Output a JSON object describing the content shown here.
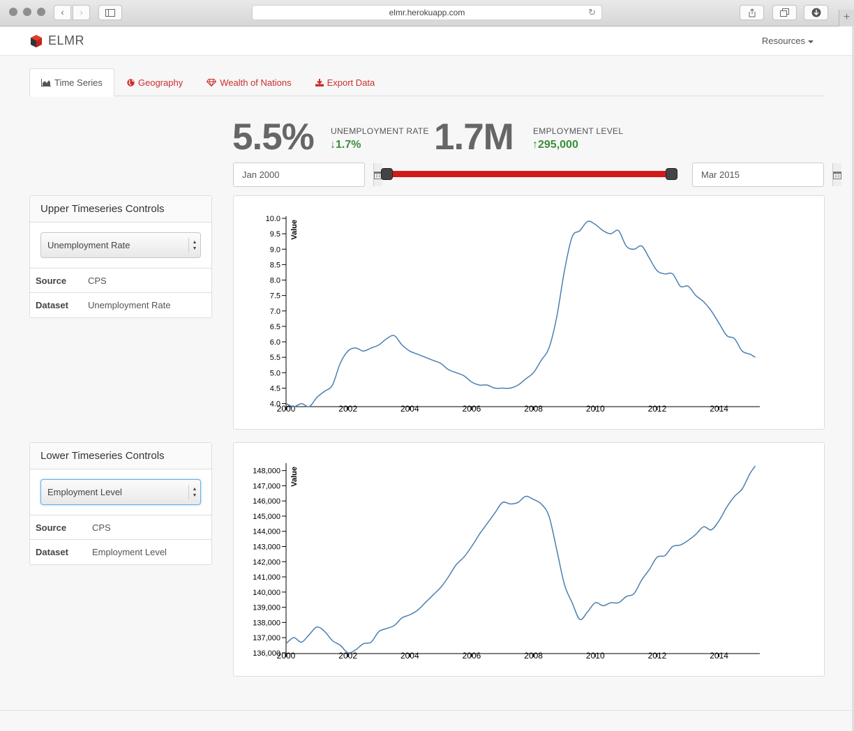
{
  "browser": {
    "url": "elmr.herokuapp.com"
  },
  "navbar": {
    "brand": "ELMR",
    "resources_label": "Resources"
  },
  "tabs": [
    {
      "label": "Time Series",
      "icon": "area-chart-icon",
      "active": true
    },
    {
      "label": "Geography",
      "icon": "globe-icon",
      "active": false
    },
    {
      "label": "Wealth of Nations",
      "icon": "diamond-icon",
      "active": false
    },
    {
      "label": "Export Data",
      "icon": "download-icon",
      "active": false
    }
  ],
  "stats": {
    "unemployment": {
      "value": "5.5%",
      "label": "UNEMPLOYMENT RATE",
      "change": "1.7%",
      "direction": "down"
    },
    "employment": {
      "value": "1.7M",
      "label": "EMPLOYMENT LEVEL",
      "change": "295,000",
      "direction": "up"
    }
  },
  "date_range": {
    "start": "Jan 2000",
    "end": "Mar 2015"
  },
  "colors": {
    "accent": "#c9302c",
    "slider": "#d11a1a",
    "positive": "#3c8d3c",
    "line": "#4a7fb0"
  },
  "upper_panel": {
    "title": "Upper Timeseries Controls",
    "selected": "Unemployment Rate",
    "rows": [
      {
        "key": "Source",
        "value": "CPS"
      },
      {
        "key": "Dataset",
        "value": "Unemployment Rate"
      }
    ]
  },
  "lower_panel": {
    "title": "Lower Timeseries Controls",
    "selected": "Employment Level",
    "rows": [
      {
        "key": "Source",
        "value": "CPS"
      },
      {
        "key": "Dataset",
        "value": "Employment Level"
      }
    ]
  },
  "chart_data": [
    {
      "type": "line",
      "ylabel": "Value",
      "xlabel": "",
      "xlim": [
        2000,
        2015.25
      ],
      "ylim": [
        3.9,
        10.0
      ],
      "xticks": [
        2000,
        2002,
        2004,
        2006,
        2008,
        2010,
        2012,
        2014
      ],
      "yticks": [
        4.0,
        4.5,
        5.0,
        5.5,
        6.0,
        6.5,
        7.0,
        7.5,
        8.0,
        8.5,
        9.0,
        9.5,
        10.0
      ],
      "ytick_labels": [
        "4.0",
        "4.5",
        "5.0",
        "5.5",
        "6.0",
        "6.5",
        "7.0",
        "7.5",
        "8.0",
        "8.5",
        "9.0",
        "9.5",
        "10.0"
      ],
      "x": [
        2000.0,
        2000.25,
        2000.5,
        2000.75,
        2001.0,
        2001.25,
        2001.5,
        2001.75,
        2002.0,
        2002.25,
        2002.5,
        2002.75,
        2003.0,
        2003.25,
        2003.5,
        2003.75,
        2004.0,
        2004.25,
        2004.5,
        2004.75,
        2005.0,
        2005.25,
        2005.5,
        2005.75,
        2006.0,
        2006.25,
        2006.5,
        2006.75,
        2007.0,
        2007.25,
        2007.5,
        2007.75,
        2008.0,
        2008.25,
        2008.5,
        2008.75,
        2009.0,
        2009.25,
        2009.5,
        2009.75,
        2010.0,
        2010.25,
        2010.5,
        2010.75,
        2011.0,
        2011.25,
        2011.5,
        2011.75,
        2012.0,
        2012.25,
        2012.5,
        2012.75,
        2013.0,
        2013.25,
        2013.5,
        2013.75,
        2014.0,
        2014.25,
        2014.5,
        2014.75,
        2015.0,
        2015.17
      ],
      "y": [
        4.0,
        3.9,
        4.0,
        3.9,
        4.2,
        4.4,
        4.6,
        5.3,
        5.7,
        5.8,
        5.7,
        5.8,
        5.9,
        6.1,
        6.2,
        5.9,
        5.7,
        5.6,
        5.5,
        5.4,
        5.3,
        5.1,
        5.0,
        4.9,
        4.7,
        4.6,
        4.6,
        4.5,
        4.5,
        4.5,
        4.6,
        4.8,
        5.0,
        5.4,
        5.8,
        6.8,
        8.3,
        9.4,
        9.6,
        9.9,
        9.8,
        9.6,
        9.5,
        9.6,
        9.1,
        9.0,
        9.1,
        8.7,
        8.3,
        8.2,
        8.2,
        7.8,
        7.8,
        7.5,
        7.3,
        7.0,
        6.6,
        6.2,
        6.1,
        5.7,
        5.6,
        5.5
      ]
    },
    {
      "type": "line",
      "ylabel": "Value",
      "xlabel": "",
      "xlim": [
        2000,
        2015.25
      ],
      "ylim": [
        135950,
        148350
      ],
      "xticks": [
        2000,
        2002,
        2004,
        2006,
        2008,
        2010,
        2012,
        2014
      ],
      "yticks": [
        136000,
        137000,
        138000,
        139000,
        140000,
        141000,
        142000,
        143000,
        144000,
        145000,
        146000,
        147000,
        148000
      ],
      "ytick_labels": [
        "136,000",
        "137,000",
        "138,000",
        "139,000",
        "140,000",
        "141,000",
        "142,000",
        "143,000",
        "144,000",
        "145,000",
        "146,000",
        "147,000",
        "148,000"
      ],
      "x": [
        2000.0,
        2000.25,
        2000.5,
        2000.75,
        2001.0,
        2001.25,
        2001.5,
        2001.75,
        2002.0,
        2002.25,
        2002.5,
        2002.75,
        2003.0,
        2003.25,
        2003.5,
        2003.75,
        2004.0,
        2004.25,
        2004.5,
        2004.75,
        2005.0,
        2005.25,
        2005.5,
        2005.75,
        2006.0,
        2006.25,
        2006.5,
        2006.75,
        2007.0,
        2007.25,
        2007.5,
        2007.75,
        2008.0,
        2008.25,
        2008.5,
        2008.75,
        2009.0,
        2009.25,
        2009.5,
        2009.75,
        2010.0,
        2010.25,
        2010.5,
        2010.75,
        2011.0,
        2011.25,
        2011.5,
        2011.75,
        2012.0,
        2012.25,
        2012.5,
        2012.75,
        2013.0,
        2013.25,
        2013.5,
        2013.75,
        2014.0,
        2014.25,
        2014.5,
        2014.75,
        2015.0,
        2015.17
      ],
      "y": [
        136600,
        137000,
        136700,
        137200,
        137700,
        137400,
        136800,
        136500,
        136000,
        136200,
        136600,
        136700,
        137400,
        137600,
        137800,
        138300,
        138500,
        138800,
        139300,
        139800,
        140300,
        141000,
        141800,
        142300,
        143000,
        143800,
        144500,
        145200,
        145900,
        145800,
        145900,
        146300,
        146100,
        145800,
        145000,
        142800,
        140500,
        139300,
        138200,
        138700,
        139300,
        139100,
        139300,
        139300,
        139700,
        139900,
        140800,
        141500,
        142300,
        142400,
        143000,
        143100,
        143400,
        143800,
        144300,
        144100,
        144700,
        145600,
        146300,
        146800,
        147800,
        148300
      ]
    }
  ]
}
